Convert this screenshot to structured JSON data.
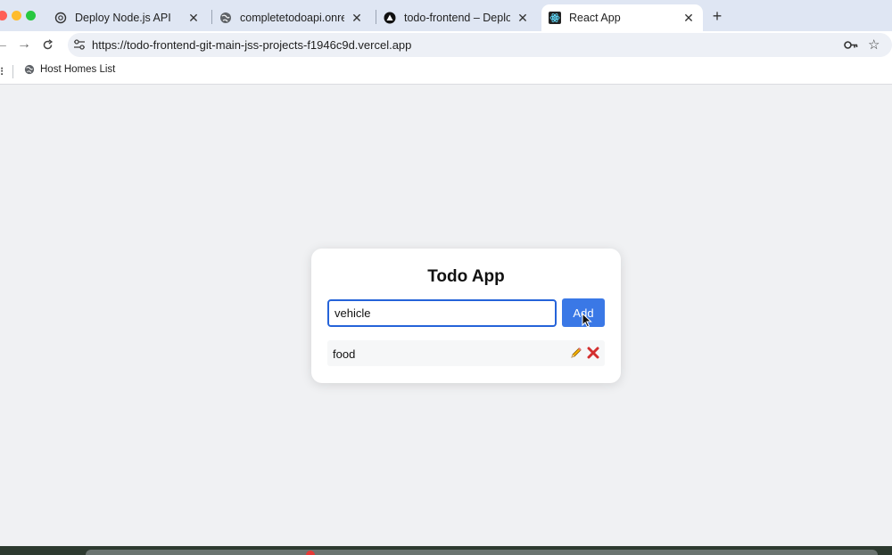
{
  "browser": {
    "tabs": [
      {
        "title": "Deploy Node.js API",
        "icon": "openai-icon"
      },
      {
        "title": "completetodoapi.onrender.co",
        "icon": "globe-icon"
      },
      {
        "title": "todo-frontend – Deployment",
        "icon": "vercel-icon"
      },
      {
        "title": "React App",
        "icon": "react-icon",
        "active": true
      }
    ],
    "url": "https://todo-frontend-git-main-jss-projects-f1946c9d.vercel.app",
    "bookmarks": [
      {
        "label": "Host Homes List",
        "icon": "globe-icon"
      }
    ]
  },
  "app": {
    "title": "Todo App",
    "input": {
      "value": "vehicle",
      "placeholder": ""
    },
    "add_label": "Add",
    "todos": [
      {
        "text": "food"
      }
    ]
  },
  "colors": {
    "accent": "#3a78e6",
    "input_border": "#2563d9",
    "delete": "#d32f2f",
    "tabstrip": "#dfe6f3"
  }
}
